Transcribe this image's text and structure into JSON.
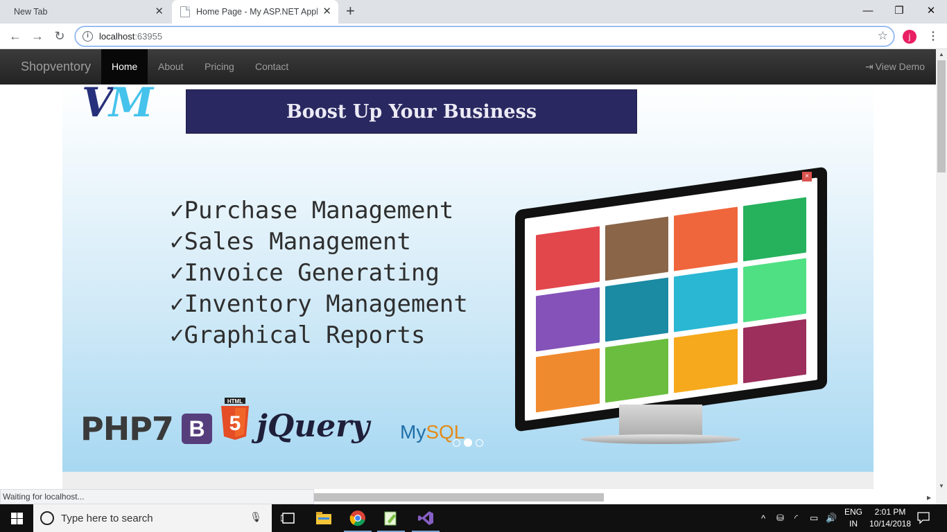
{
  "browser": {
    "tabs": [
      {
        "title": "New Tab",
        "active": false
      },
      {
        "title": "Home Page - My ASP.NET Applic",
        "active": true
      }
    ],
    "new_tab_symbol": "+",
    "close_symbol": "✕",
    "window_controls": {
      "minimize": "—",
      "restore": "❐",
      "close": "✕"
    },
    "back_symbol": "←",
    "forward_symbol": "→",
    "reload_symbol": "↻",
    "url_host": "localhost",
    "url_port": ":63955",
    "info_symbol": "i",
    "star_symbol": "☆",
    "profile_initial": "j",
    "menu_symbol": "⋮",
    "status_text": "Waiting for localhost..."
  },
  "navbar": {
    "brand": "Shopventory",
    "links": [
      {
        "label": "Home",
        "active": true
      },
      {
        "label": "About",
        "active": false
      },
      {
        "label": "Pricing",
        "active": false
      },
      {
        "label": "Contact",
        "active": false
      }
    ],
    "view_demo": "View Demo",
    "view_demo_icon": "⇥"
  },
  "banner": {
    "logo_v": "V",
    "logo_m": "M",
    "headline": "Boost Up Your  Business",
    "features": [
      "✓Purchase Management",
      "✓Sales Management",
      "✓Invoice Generating",
      "✓Inventory Management",
      "✓Graphical Reports"
    ],
    "tech": {
      "php": "PHP7",
      "bootstrap": "B",
      "html_label": "HTML",
      "html5": "5",
      "jquery": "jQuery",
      "mysql_my": "My",
      "mysql_sql": "SQL"
    },
    "carousel": {
      "count": 3,
      "active_index": 1
    },
    "tile_colors": [
      "#e2474c",
      "#8a6548",
      "#f0663c",
      "#26b15d",
      "#8452b8",
      "#1b8aa3",
      "#29b7d4",
      "#4fe083",
      "#f08a2e",
      "#6bbd3f",
      "#f6a91d",
      "#9c2f5c"
    ]
  },
  "taskbar": {
    "search_placeholder": "Type here to search",
    "lang_top": "ENG",
    "lang_bottom": "IN",
    "time": "2:01 PM",
    "date": "10/14/2018"
  }
}
